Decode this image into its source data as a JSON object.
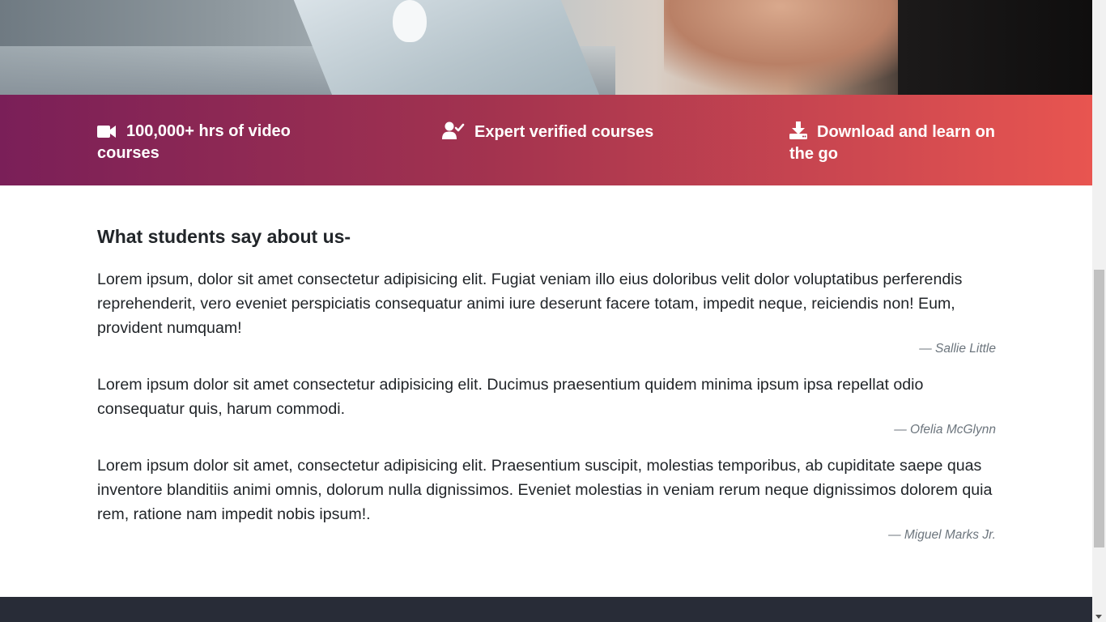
{
  "features": [
    {
      "icon": "video-camera-icon",
      "label": "100,000+ hrs of video courses"
    },
    {
      "icon": "user-check-icon",
      "label": "Expert verified courses"
    },
    {
      "icon": "download-icon",
      "label": "Download and learn on the go"
    }
  ],
  "testimonials": {
    "title": "What students say about us-",
    "items": [
      {
        "quote": "Lorem ipsum, dolor sit amet consectetur adipisicing elit. Fugiat veniam illo eius doloribus velit dolor voluptatibus perferendis reprehenderit, vero eveniet perspiciatis consequatur animi iure deserunt facere totam, impedit neque, reiciendis non! Eum, provident numquam!",
        "author": "— Sallie Little"
      },
      {
        "quote": "Lorem ipsum dolor sit amet consectetur adipisicing elit. Ducimus praesentium quidem minima ipsum ipsa repellat odio consequatur quis, harum commodi.",
        "author": "— Ofelia McGlynn"
      },
      {
        "quote": "Lorem ipsum dolor sit amet, consectetur adipisicing elit. Praesentium suscipit, molestias temporibus, ab cupiditate saepe quas inventore blanditiis animi omnis, dolorum nulla dignissimos. Eveniet molestias in veniam rerum neque dignissimos dolorem quia rem, ratione nam impedit nobis ipsum!.",
        "author": "— Miguel Marks Jr."
      }
    ]
  },
  "colors": {
    "band_start": "#7a1f58",
    "band_end": "#e85550",
    "footer": "#282c37",
    "author_text": "#6c757d"
  }
}
